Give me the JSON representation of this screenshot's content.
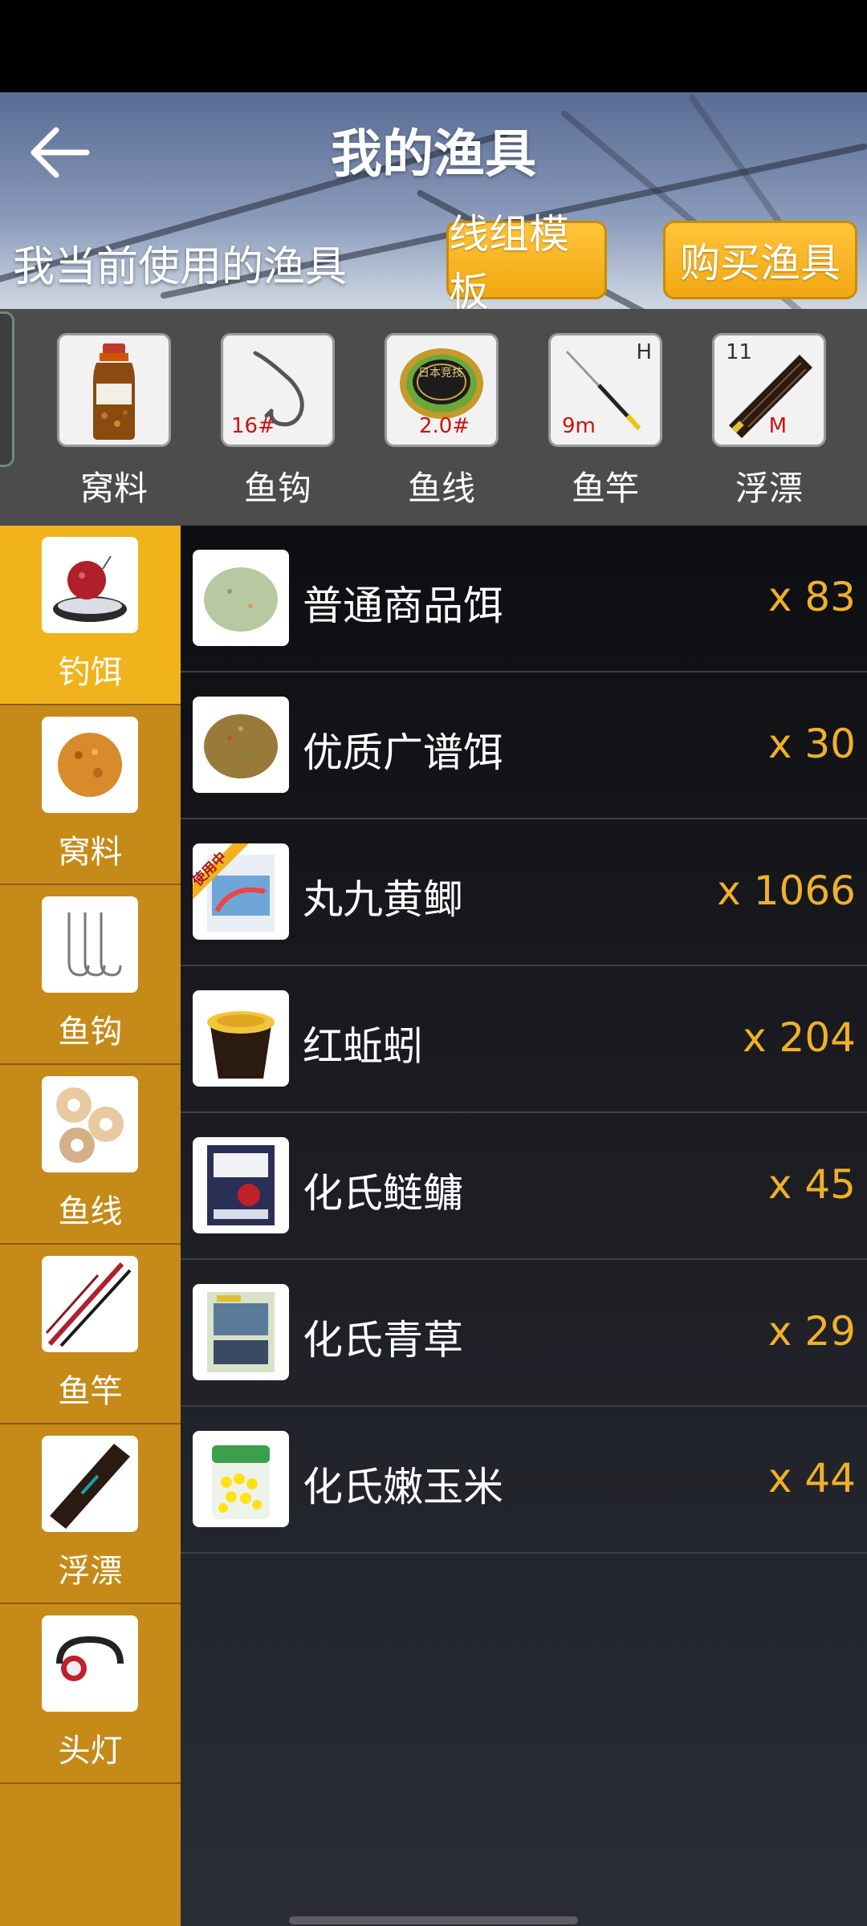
{
  "header": {
    "title": "我的渔具",
    "subtitle": "我当前使用的渔具",
    "template_button": "线组模板",
    "buy_button": "购买渔具"
  },
  "equipped": [
    {
      "label": "窝料",
      "icon": "bait-bottle-icon"
    },
    {
      "label": "鱼钩",
      "icon": "hook-icon",
      "tag": "16#"
    },
    {
      "label": "鱼线",
      "icon": "line-spool-icon",
      "tag": "2.0#",
      "spool_text": "日本竞技"
    },
    {
      "label": "鱼竿",
      "icon": "rod-icon",
      "tag": "9m",
      "corner": "H"
    },
    {
      "label": "浮漂",
      "icon": "float-icon",
      "tag": "M",
      "corner": "11"
    }
  ],
  "categories": [
    {
      "label": "钓饵",
      "icon": "bait-icon",
      "active": true
    },
    {
      "label": "窝料",
      "icon": "groundbait-icon",
      "active": false
    },
    {
      "label": "鱼钩",
      "icon": "hooks-icon",
      "active": false
    },
    {
      "label": "鱼线",
      "icon": "fishing-line-icon",
      "active": false
    },
    {
      "label": "鱼竿",
      "icon": "fishing-rod-icon",
      "active": false
    },
    {
      "label": "浮漂",
      "icon": "bobber-icon",
      "active": false
    },
    {
      "label": "头灯",
      "icon": "headlamp-icon",
      "active": false
    }
  ],
  "items": [
    {
      "name": "普通商品饵",
      "qty": "x 83",
      "icon": "green-bait-ball-icon"
    },
    {
      "name": "优质广谱饵",
      "qty": "x 30",
      "icon": "brown-bait-ball-icon"
    },
    {
      "name": "丸九黄鲫",
      "qty": "x 1066",
      "icon": "bait-package-icon",
      "badge": "使用中"
    },
    {
      "name": "红蚯蚓",
      "qty": "x 204",
      "icon": "worm-cup-icon"
    },
    {
      "name": "化氏鲢鳙",
      "qty": "x 45",
      "icon": "bait-bag-icon"
    },
    {
      "name": "化氏青草",
      "qty": "x 29",
      "icon": "bait-bag-blue-icon"
    },
    {
      "name": "化氏嫩玉米",
      "qty": "x 44",
      "icon": "corn-jar-icon"
    }
  ],
  "colors": {
    "accent": "#f1b31c",
    "sidebar": "#c68a18",
    "qty": "#f0b02a"
  }
}
